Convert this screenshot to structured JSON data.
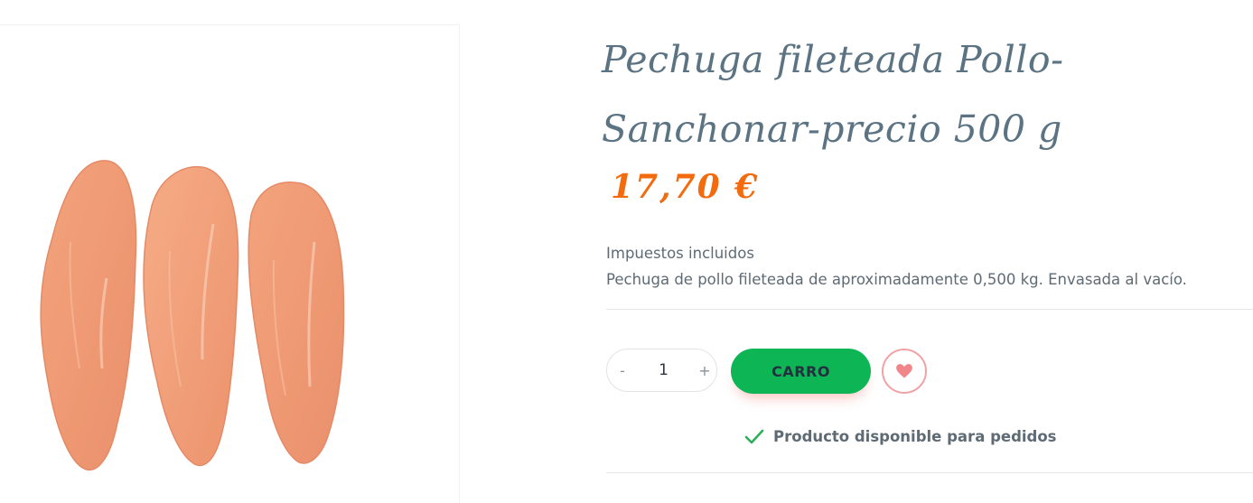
{
  "product": {
    "title": "Pechuga fileteada Pollo-Sanchonar-precio 500 g",
    "price": "17,70 €",
    "tax_note": "Impuestos incluidos",
    "description": "Pechuga de pollo fileteada de aproximadamente 0,500 kg. Envasada al vacío.",
    "image_icon": "chicken-breast-image"
  },
  "quantity": {
    "minus_label": "-",
    "value": "1",
    "plus_label": "+"
  },
  "actions": {
    "cart_label": "CARRO",
    "wishlist_icon": "heart-icon"
  },
  "availability": {
    "icon": "check-icon",
    "text": "Producto disponible para pedidos"
  },
  "colors": {
    "title": "#5b7382",
    "price": "#f26b0f",
    "cart_button": "#0db554",
    "wishlist": "#f0858a",
    "check": "#2eae5b"
  }
}
